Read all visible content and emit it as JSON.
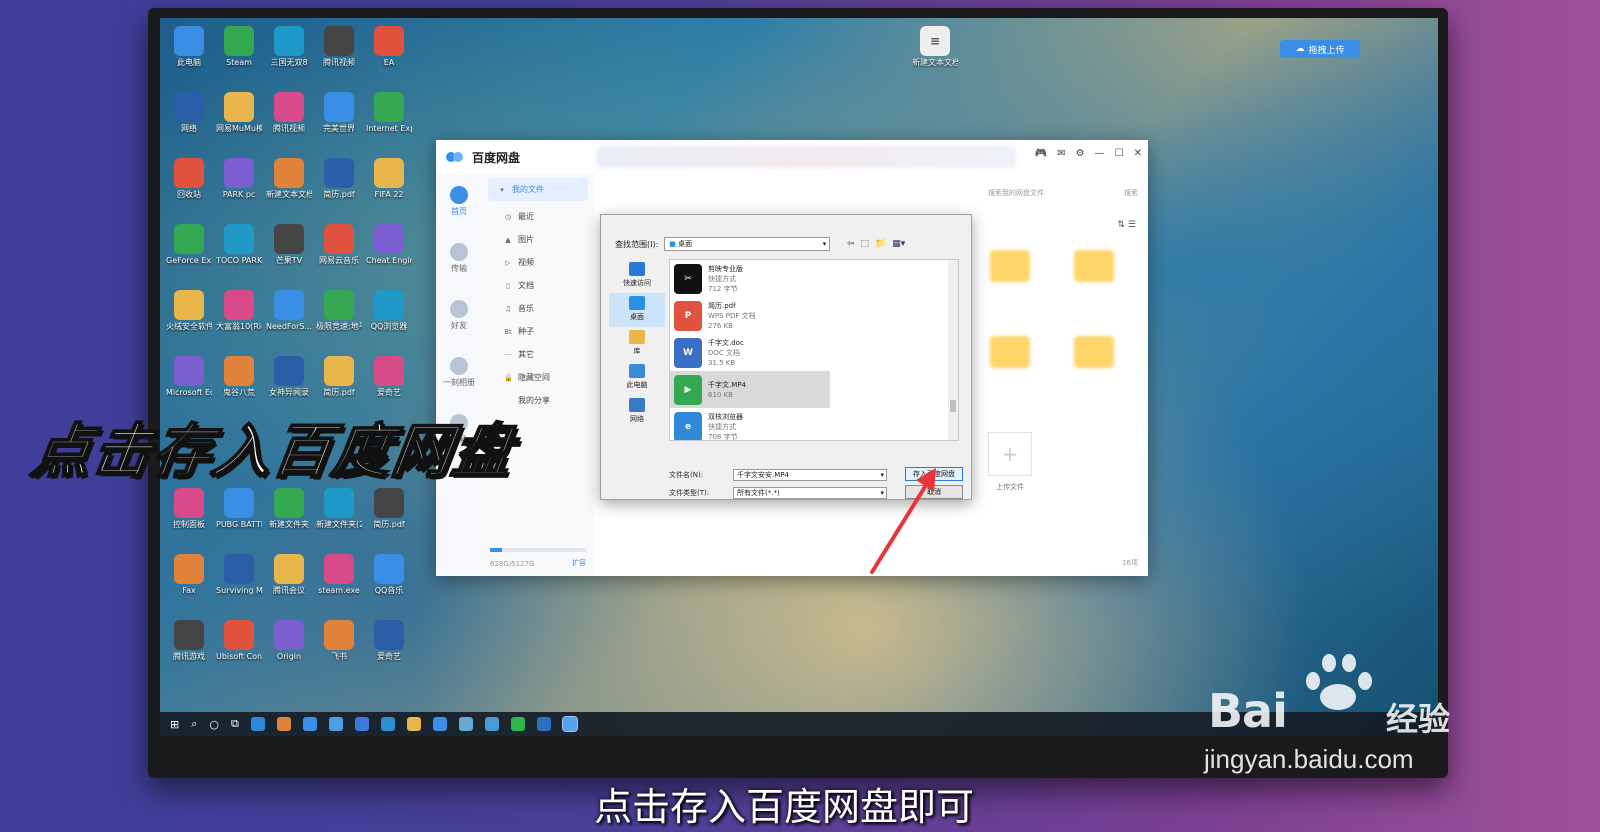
{
  "desktop": {
    "icons_col1": [
      "此电脑",
      "网络",
      "回收站",
      "GeForce Experience",
      "火绒安全软件",
      "Microsoft Edge",
      "",
      "控制面板",
      "Fax",
      "腾讯游戏"
    ],
    "icons_col2": [
      "Steam",
      "网易MuMu模拟器",
      "PARK pc",
      "TOCO PARK",
      "大富翁10(Richm...",
      "鬼谷八荒",
      "",
      "PUBG BATTLEGR...",
      "Surviving Mars",
      "Ubisoft Connect"
    ],
    "icons_col3": [
      "三国无双8",
      "腾讯视频",
      "新建文本文档",
      "芒果TV",
      "NeedForS...快捷方式",
      "女神异闻录",
      "",
      "新建文件夹",
      "腾讯会议",
      "Origin"
    ],
    "icons_col4": [
      "腾讯视频",
      "完美世界",
      "简历.pdf",
      "网易云音乐",
      "极限竞速:地平线5",
      "简历.pdf",
      "",
      "新建文件夹(2)",
      "steam.exe",
      "飞书"
    ],
    "icons_col5": [
      "EA",
      "Internet Explorer",
      "FIFA 22",
      "Cheat Engine",
      "QQ浏览器",
      "爱奇艺",
      "",
      "简历.pdf",
      "QQ音乐",
      "爱奇艺"
    ],
    "top_right_file": "新建文本文档.txt",
    "upload_pill": "拖拽上传"
  },
  "baidu_window": {
    "title": "百度网盘",
    "nav": [
      {
        "label": "首页",
        "active": true
      },
      {
        "label": "传输",
        "active": false
      },
      {
        "label": "好友",
        "active": false
      },
      {
        "label": "一刻相册",
        "active": false
      },
      {
        "label": "工具",
        "active": false
      }
    ],
    "sidebar": [
      {
        "icon": "▾",
        "label": "我的文件",
        "active": true
      },
      {
        "icon": "◷",
        "label": "最近",
        "active": false
      },
      {
        "icon": "▲",
        "label": "图片",
        "active": false
      },
      {
        "icon": "▷",
        "label": "视频",
        "active": false
      },
      {
        "icon": "▯",
        "label": "文档",
        "active": false
      },
      {
        "icon": "♫",
        "label": "音乐",
        "active": false
      },
      {
        "icon": "Bt",
        "label": "种子",
        "active": false
      },
      {
        "icon": "···",
        "label": "其它",
        "active": false
      },
      {
        "icon": "🔒",
        "label": "隐藏空间",
        "active": false
      },
      {
        "icon": "",
        "label": "我的分享",
        "active": false
      }
    ],
    "storage_text": "628G/5127G",
    "expand_label": "扩容",
    "search_placeholder": "搜索我的网盘文件",
    "search_button": "搜索",
    "upload_tile_label": "上传文件",
    "item_count": "16项"
  },
  "save_dialog": {
    "look_in_label": "查找范围(I):",
    "look_in_value": "桌面",
    "places": [
      {
        "label": "快速访问",
        "color": "#2a78d6",
        "active": false
      },
      {
        "label": "桌面",
        "color": "#2a90e0",
        "active": true
      },
      {
        "label": "库",
        "color": "#e8b64a",
        "active": false
      },
      {
        "label": "此电脑",
        "color": "#3b8ad8",
        "active": false
      },
      {
        "label": "网络",
        "color": "#3a78c8",
        "active": false
      }
    ],
    "files": [
      {
        "name": "剪映专业版",
        "type": "快捷方式",
        "size": "712 字节",
        "icon_text": "✂",
        "icon_color": "#111111",
        "selected": false
      },
      {
        "name": "简历.pdf",
        "type": "WPS PDF 文档",
        "size": "276 KB",
        "icon_text": "P",
        "icon_color": "#e0523d",
        "selected": false
      },
      {
        "name": "千字文.doc",
        "type": "DOC 文档",
        "size": "31.5 KB",
        "icon_text": "W",
        "icon_color": "#3b6fc5",
        "selected": false
      },
      {
        "name": "千字文.MP4",
        "type": "",
        "size": "610 KB",
        "icon_text": "▶",
        "icon_color": "#35a852",
        "selected": true
      },
      {
        "name": "双核浏览器",
        "type": "快捷方式",
        "size": "708 字节",
        "icon_text": "e",
        "icon_color": "#2f88d8",
        "selected": false
      }
    ],
    "filename_label": "文件名(N):",
    "filename_value": "千字文安安.MP4",
    "filetype_label": "文件类型(T):",
    "filetype_value": "所有文件(*.*)",
    "save_button": "存入百度网盘",
    "cancel_button": "取消"
  },
  "overlay": {
    "caption_big": "点击存入百度网盘",
    "subtitle": "点击存入百度网盘即可"
  },
  "watermark": {
    "brand": "Bai",
    "brand_cn": "经验",
    "url": "jingyan.baidu.com"
  },
  "colors": {
    "accent": "#3a8ee6",
    "arrow": "#e8343a"
  }
}
